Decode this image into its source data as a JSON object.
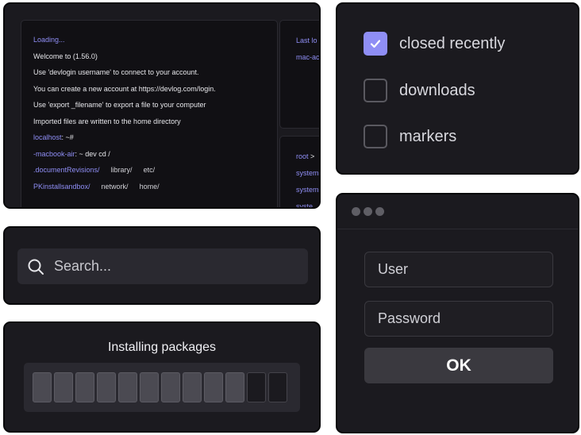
{
  "terminal": {
    "lines": [
      {
        "text": "Loading...",
        "style": "accent"
      },
      {
        "text": "Welcome to  (1.56.0)",
        "style": "normal"
      },
      {
        "text": "Use 'devlogin username' to connect to your account.",
        "style": "normal"
      },
      {
        "text": "You can create a new account at https://devlog.com/login.",
        "style": "normal"
      },
      {
        "text": "Use 'export _filename' to export a file to your computer",
        "style": "normal"
      },
      {
        "text": "Imported files are written to the home directory",
        "style": "normal"
      }
    ],
    "prompt": {
      "host": "localhost",
      "suffix": ": ~#"
    },
    "command": {
      "host": "-macbook-air",
      "suffix": ": ~ dev cd /"
    },
    "listing": [
      {
        "accent": ".documentRevisions/",
        "items": [
          "library/",
          "etc/"
        ]
      },
      {
        "accent": "PKinstallsandbox/",
        "items": [
          "network/",
          "home/"
        ]
      }
    ],
    "side_top": {
      "line1": "Last lo",
      "line2": "mac-ac"
    },
    "side_bottom": {
      "line1_root": "root",
      "line1_sep": " >",
      "line2": "system",
      "line3": "system",
      "line4": "syste"
    }
  },
  "checklist": {
    "items": [
      {
        "label": "closed recently",
        "checked": true
      },
      {
        "label": "downloads",
        "checked": false
      },
      {
        "label": "markers",
        "checked": false
      }
    ]
  },
  "search": {
    "placeholder": "Search..."
  },
  "install": {
    "title": "Installing packages",
    "progress_filled": 10,
    "progress_total": 12
  },
  "login": {
    "user_placeholder": "User",
    "password_placeholder": "Password",
    "ok_label": "OK"
  },
  "colors": {
    "accent": "#8f8ef5",
    "card_bg": "#1b1a1f",
    "field_bg": "#2a2930"
  }
}
